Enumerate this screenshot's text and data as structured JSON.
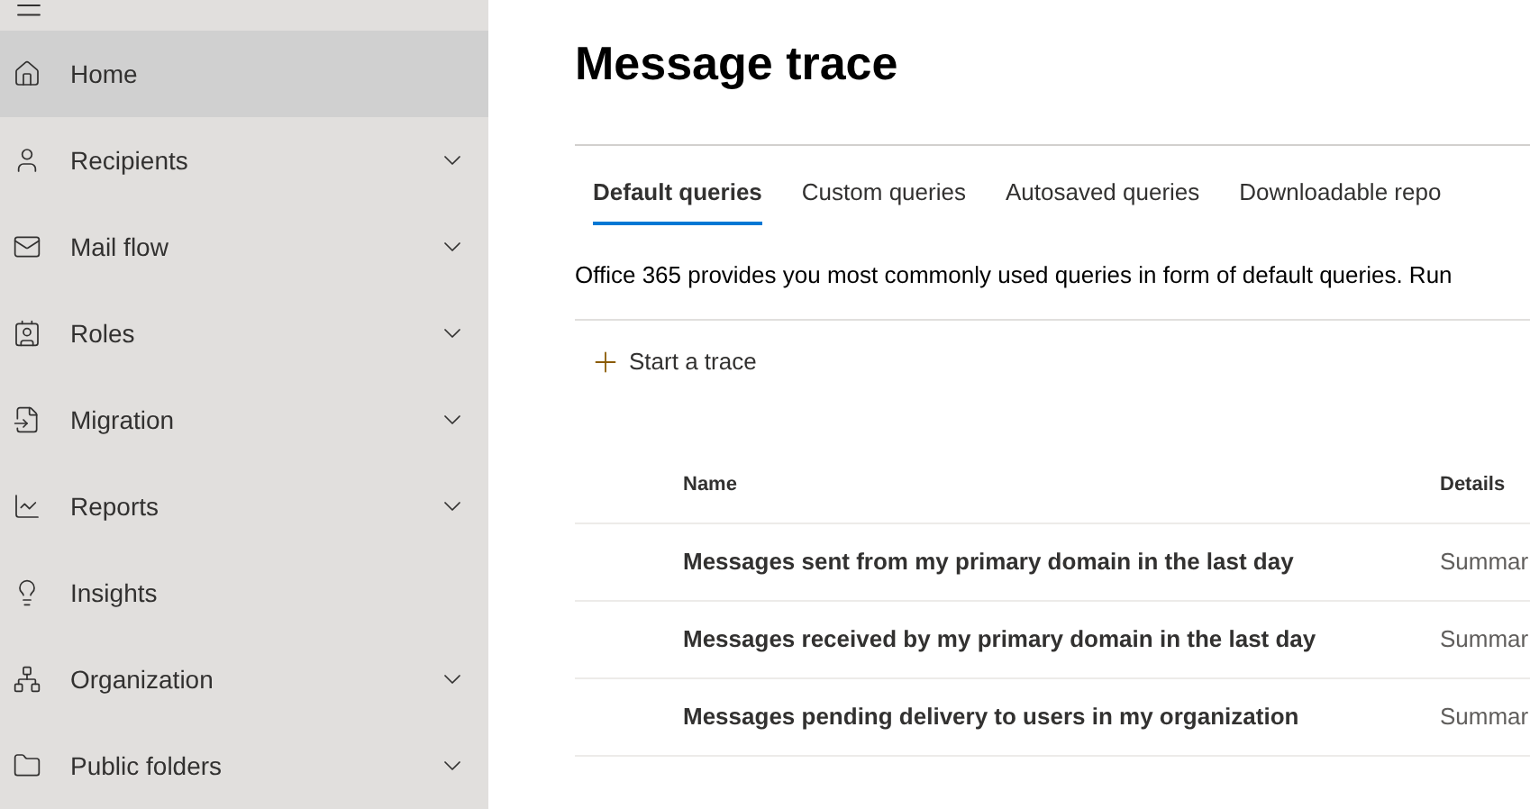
{
  "sidebar": {
    "items": [
      {
        "label": "Home",
        "selected": true,
        "expandable": false
      },
      {
        "label": "Recipients",
        "selected": false,
        "expandable": true
      },
      {
        "label": "Mail flow",
        "selected": false,
        "expandable": true
      },
      {
        "label": "Roles",
        "selected": false,
        "expandable": true
      },
      {
        "label": "Migration",
        "selected": false,
        "expandable": true
      },
      {
        "label": "Reports",
        "selected": false,
        "expandable": true
      },
      {
        "label": "Insights",
        "selected": false,
        "expandable": false
      },
      {
        "label": "Organization",
        "selected": false,
        "expandable": true
      },
      {
        "label": "Public folders",
        "selected": false,
        "expandable": true
      }
    ]
  },
  "page": {
    "title": "Message trace"
  },
  "tabs": [
    {
      "label": "Default queries",
      "selected": true
    },
    {
      "label": "Custom queries",
      "selected": false
    },
    {
      "label": "Autosaved queries",
      "selected": false
    },
    {
      "label": "Downloadable repo",
      "selected": false
    }
  ],
  "description": "Office 365 provides you most commonly used queries in form of default queries. Run",
  "toolbar": {
    "start_button": "Start a trace"
  },
  "table": {
    "columns": [
      "Name",
      "Details"
    ],
    "rows": [
      {
        "name": "Messages sent from my primary domain in the last day",
        "details": "Summar"
      },
      {
        "name": "Messages received by my primary domain in the last day",
        "details": "Summar"
      },
      {
        "name": "Messages pending delivery to users in my organization",
        "details": "Summar"
      }
    ]
  }
}
